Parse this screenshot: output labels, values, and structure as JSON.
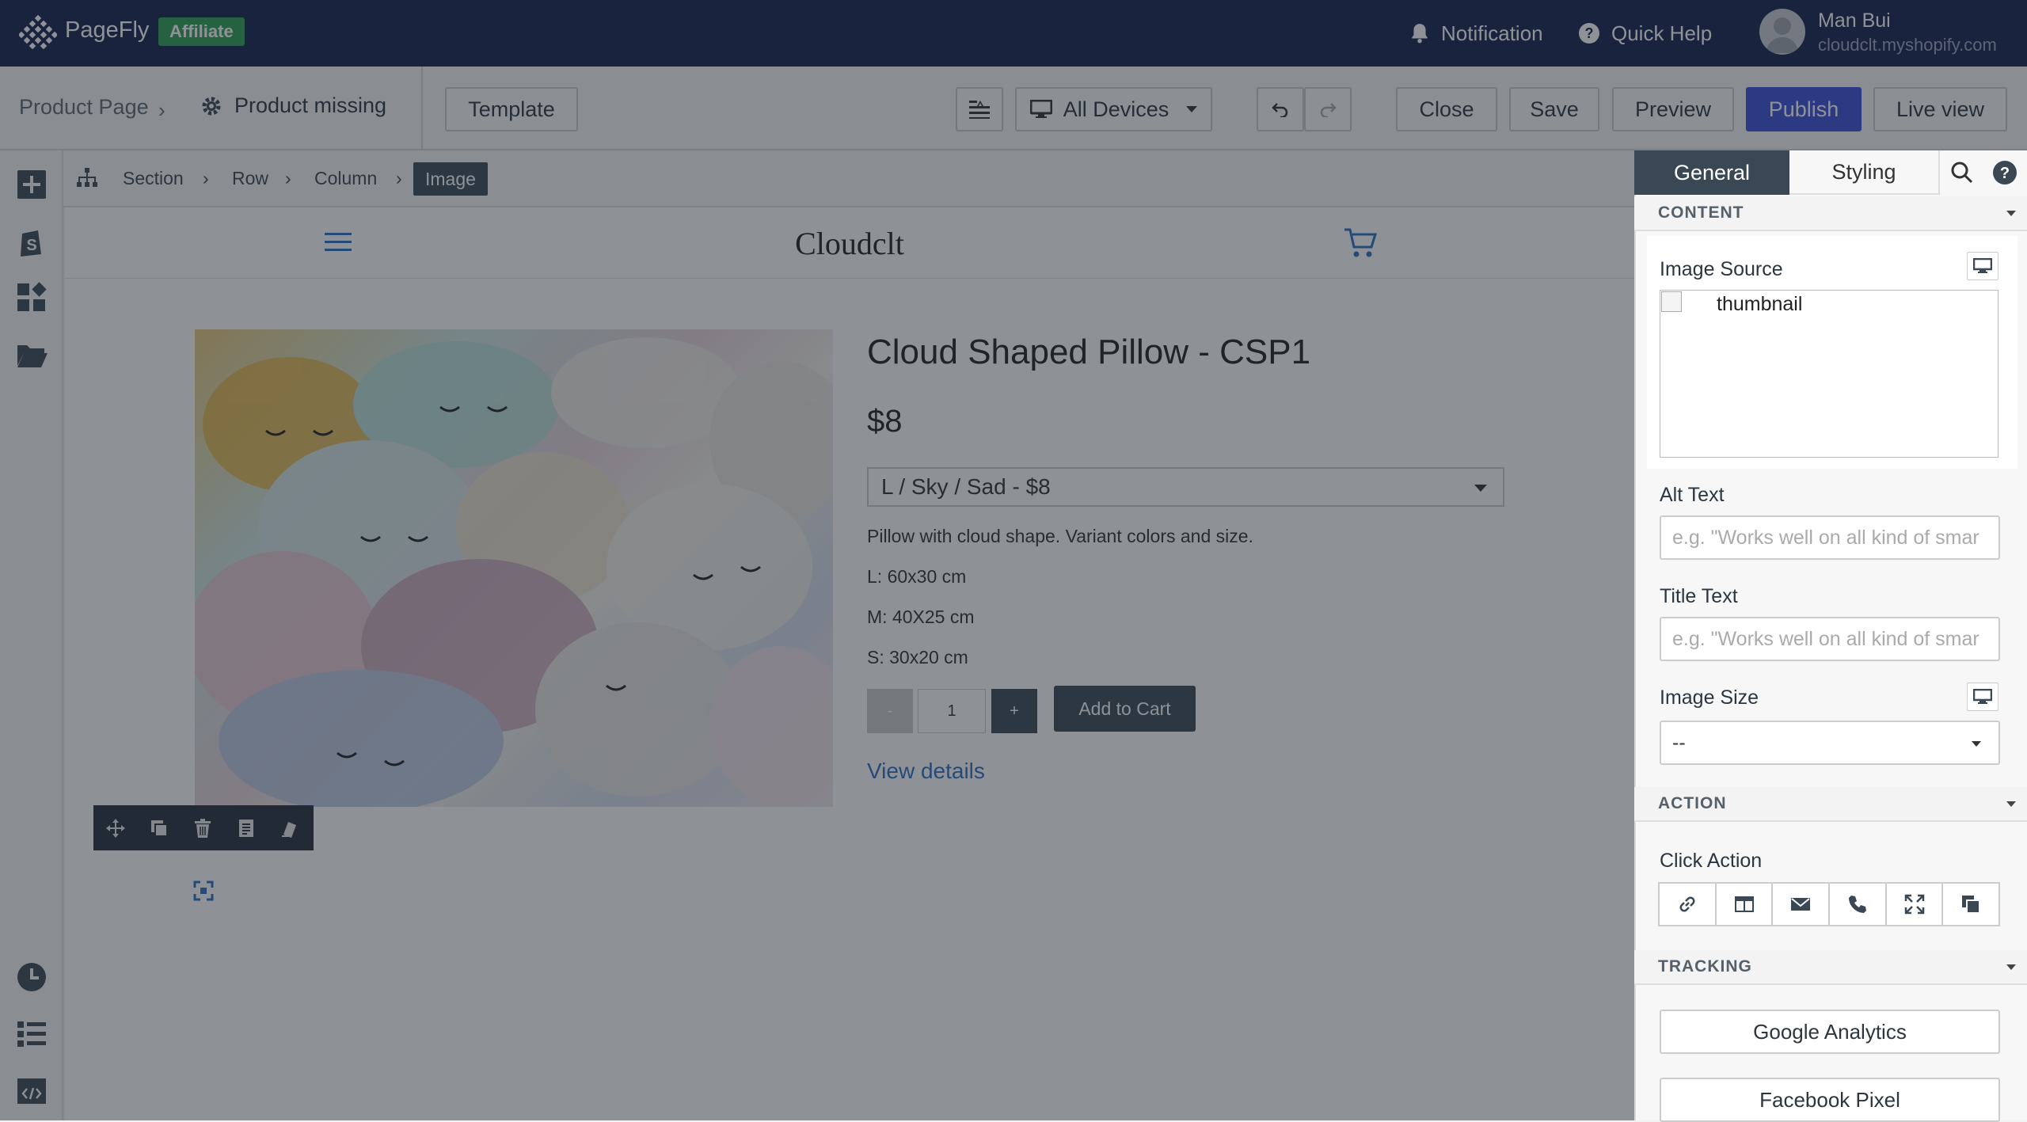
{
  "header": {
    "brand": "PageFly",
    "badge": "Affiliate",
    "notification": "Notification",
    "quick_help": "Quick Help",
    "user_name": "Man Bui",
    "user_store": "cloudclt.myshopify.com"
  },
  "toolbar": {
    "page_type": "Product Page",
    "page_name": "Product missing",
    "template": "Template",
    "devices": "All Devices",
    "close": "Close",
    "save": "Save",
    "preview": "Preview",
    "publish": "Publish",
    "live_view": "Live view"
  },
  "breadcrumb": [
    "Section",
    "Row",
    "Column",
    "Image"
  ],
  "store": {
    "name": "Cloudclt"
  },
  "product": {
    "title": "Cloud Shaped Pillow - CSP1",
    "price": "$8",
    "variant": "L / Sky / Sad - $8",
    "description": "Pillow with cloud shape. Variant colors and size.",
    "sizes": [
      "L: 60x30 cm",
      "M: 40X25 cm",
      "S: 30x20 cm"
    ],
    "qty_minus": "-",
    "quantity": "1",
    "qty_plus": "+",
    "add_to_cart": "Add to Cart",
    "view_details": "View details"
  },
  "panel": {
    "tabs": [
      "General",
      "Styling"
    ],
    "sections": {
      "content": "CONTENT",
      "action": "ACTION",
      "tracking": "TRACKING"
    },
    "image_source_label": "Image Source",
    "thumbnail_alt": "thumbnail",
    "alt_text_label": "Alt Text",
    "alt_text_placeholder": "e.g. \"Works well on all kind of smar",
    "title_text_label": "Title Text",
    "title_text_placeholder": "e.g. \"Works well on all kind of smar",
    "image_size_label": "Image Size",
    "image_size_value": "--",
    "click_action_label": "Click Action",
    "google_analytics": "Google Analytics",
    "facebook_pixel": "Facebook Pixel"
  },
  "colors": {
    "header_bg": "#17214d",
    "affiliate_badge": "#2f9e54",
    "publish_button": "#3b4fd6",
    "active_tab": "#3a4855",
    "link": "#2f6fc0"
  },
  "icons": [
    "pagefly-logo-icon",
    "bell-icon",
    "help-icon",
    "avatar",
    "gear-icon",
    "text-align-icon",
    "desktop-icon",
    "caret-down-icon",
    "undo-icon",
    "redo-icon",
    "add-element-icon",
    "shopify-icon",
    "layout-icon",
    "folder-icon",
    "history-icon",
    "outline-icon",
    "code-icon",
    "sitemap-icon",
    "hamburger-icon",
    "cart-icon",
    "move-icon",
    "duplicate-icon",
    "trash-icon",
    "copy-style-icon",
    "paste-style-icon",
    "resize-icon",
    "search-icon",
    "link-icon",
    "popup-icon",
    "email-icon",
    "phone-icon",
    "lightbox-icon",
    "layers-icon"
  ]
}
